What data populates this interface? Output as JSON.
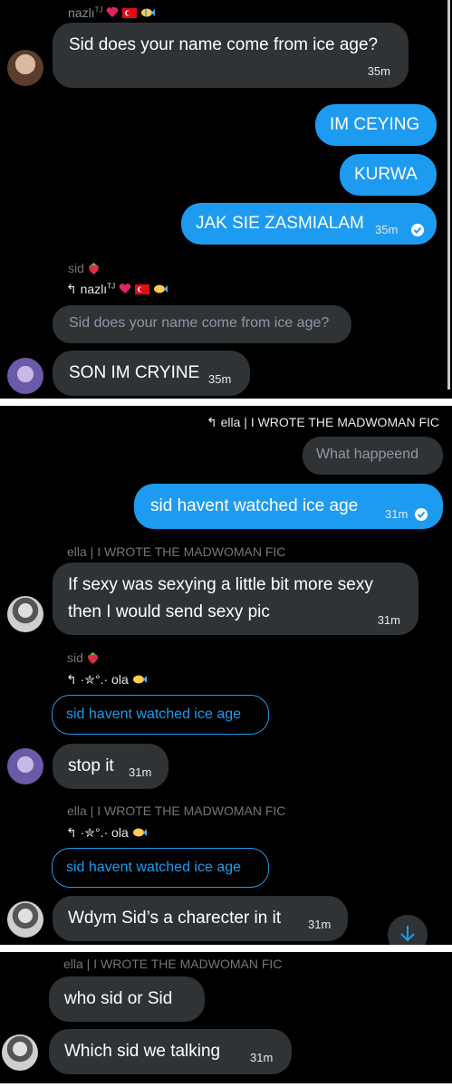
{
  "panel1": {
    "sender_top": "nazlı",
    "sender_top_sup": "TJ",
    "msg1": {
      "text": "Sid does your name come from ice age?",
      "time": "35m"
    },
    "out1": {
      "text": "IM CEYING"
    },
    "out2": {
      "text": "KURWA"
    },
    "out3": {
      "text": "JAK SIE ZASMIALAM",
      "time": "35m"
    },
    "sender2": "sid",
    "reply_to": "nazlı",
    "reply_sup": "TJ",
    "quoted": "Sid does your name come from ice age?",
    "msg2": {
      "text": "SON IM CRYINE",
      "time": "35m"
    }
  },
  "panel2": {
    "reply_header": "ella | I WROTE THE MADWOMAN FIC",
    "quoted_out": "What happeend",
    "out1": {
      "text": "sid havent watched ice age",
      "time": "31m"
    },
    "sender_ella": "ella | I WROTE THE MADWOMAN FIC",
    "msg_ella1": {
      "line1": "If sexy was sexying a little bit more sexy",
      "line2": "then I would send sexy pic",
      "time": "31m"
    },
    "sender_sid": "sid",
    "reply_to_ola": "·✮°.· ola",
    "quoted1": "sid havent watched ice age",
    "msg_sid": {
      "text": "stop it",
      "time": "31m"
    },
    "sender_ella2": "ella | I WROTE THE MADWOMAN FIC",
    "reply_to_ola2": "·✮°.· ola",
    "quoted2": "sid havent watched ice age",
    "msg_ella2": {
      "text": "Wdym Sid’s a charecter in it",
      "time": "31m"
    }
  },
  "panel3": {
    "sender": "ella | I WROTE THE MADWOMAN FIC",
    "msg1": {
      "text": "who sid or Sid"
    },
    "msg2": {
      "text": "Which sid we talking",
      "time": "31m"
    }
  },
  "icons": [
    "heart-fire-icon",
    "turkey-flag-icon",
    "tropical-fish-icon",
    "strawberry-icon",
    "reply-arrow-icon",
    "read-check-icon",
    "scroll-down-icon"
  ],
  "colors": {
    "background": "#000000",
    "incoming": "#2f3336",
    "outgoing": "#1d9bf0",
    "muted": "#71767b",
    "accent": "#1d9bf0"
  }
}
